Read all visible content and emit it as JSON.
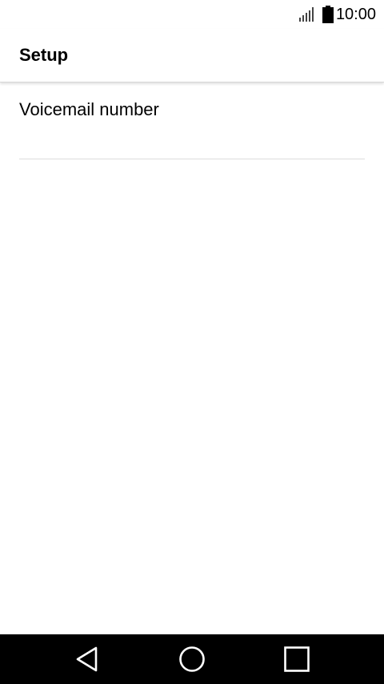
{
  "status_bar": {
    "time": "10:00",
    "signal_icon": "signal-bars-icon",
    "battery_icon": "battery-full-icon"
  },
  "app_bar": {
    "title": "Setup"
  },
  "settings": {
    "items": [
      {
        "label": "Voicemail number"
      }
    ]
  },
  "nav_bar": {
    "back_icon": "back-triangle-icon",
    "home_icon": "home-circle-icon",
    "recents_icon": "recents-square-icon"
  },
  "colors": {
    "background": "#ffffff",
    "text": "#000000",
    "divider": "#dcdcdc",
    "nav_background": "#000000",
    "nav_icon": "#ffffff"
  }
}
